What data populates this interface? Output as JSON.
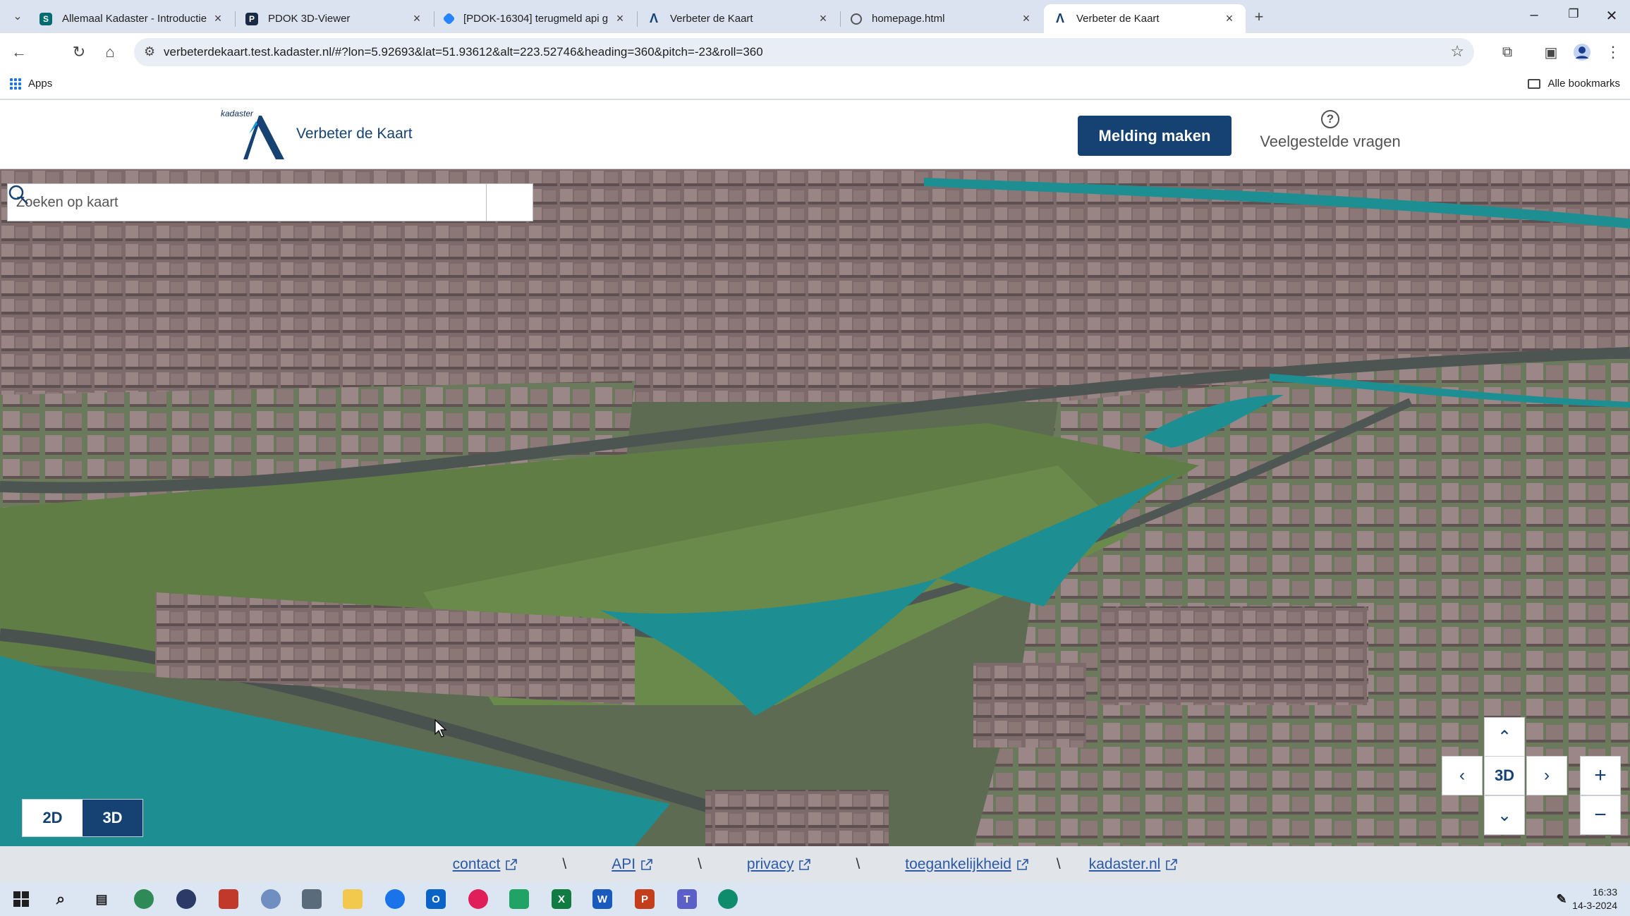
{
  "browser": {
    "tabs": [
      {
        "title": "Allemaal Kadaster - Introductie",
        "icon": "sharepoint-icon"
      },
      {
        "title": "PDOK 3D-Viewer",
        "icon": "pdok-icon"
      },
      {
        "title": "[PDOK-16304] terugmeld api g",
        "icon": "jira-icon"
      },
      {
        "title": "Verbeter de Kaart",
        "icon": "kadaster-icon"
      },
      {
        "title": "homepage.html",
        "icon": "globe-icon"
      },
      {
        "title": "Verbeter de Kaart",
        "icon": "kadaster-icon"
      }
    ],
    "url": "verbeterdekaart.test.kadaster.nl/#?lon=5.92693&lat=51.93612&alt=223.52746&heading=360&pitch=-23&roll=360",
    "bookmarks": {
      "apps": "Apps",
      "all": "Alle bookmarks"
    }
  },
  "header": {
    "brand": "kadaster",
    "title": "Verbeter de Kaart",
    "report_button": "Melding maken",
    "faq": "Veelgestelde vragen"
  },
  "map": {
    "search_placeholder": "Zoeken op kaart",
    "compass_label": "3D",
    "mode_2d": "2D",
    "mode_3d": "3D",
    "zoom_in": "+",
    "zoom_out": "−",
    "active_mode": "3D"
  },
  "footer": {
    "links": [
      "contact",
      "API",
      "privacy",
      "toegankelijkheid",
      "kadaster.nl"
    ],
    "separator": "\\"
  },
  "taskbar": {
    "time": "16:33",
    "date": "14-3-2024"
  },
  "colors": {
    "brand": "#154273",
    "link": "#2b5aa6",
    "water": "#1d8f93",
    "building": "#8a7474",
    "grass": "#5f7d45"
  }
}
